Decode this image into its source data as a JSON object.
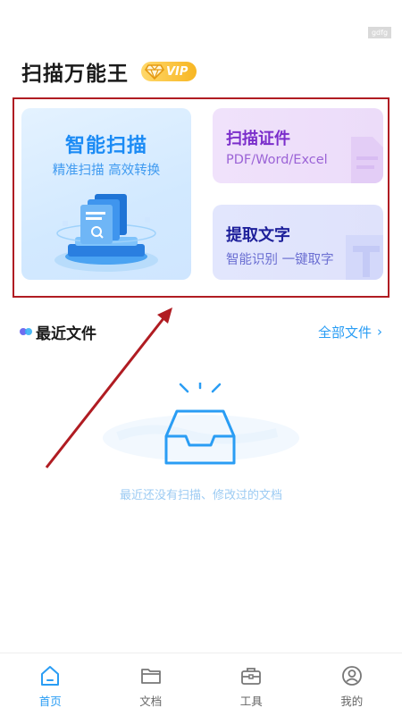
{
  "watermark": {
    "text": "gdfg"
  },
  "header": {
    "title": "扫描万能王",
    "vip_label": "VIP"
  },
  "cards": {
    "smart_scan": {
      "title": "智能扫描",
      "subtitle": "精准扫描 高效转换"
    },
    "scan_id": {
      "title": "扫描证件",
      "subtitle": "PDF/Word/Excel"
    },
    "extract_text": {
      "title": "提取文字",
      "subtitle": "智能识别 一键取字"
    }
  },
  "recent": {
    "title": "最近文件",
    "all_files_label": "全部文件"
  },
  "empty_state": {
    "text": "最近还没有扫描、修改过的文档"
  },
  "tabbar": {
    "items": [
      {
        "label": "首页",
        "icon": "home-icon",
        "active": true
      },
      {
        "label": "文档",
        "icon": "folder-icon",
        "active": false
      },
      {
        "label": "工具",
        "icon": "toolbox-icon",
        "active": false
      },
      {
        "label": "我的",
        "icon": "user-icon",
        "active": false
      }
    ]
  },
  "colors": {
    "accent": "#2a9df4",
    "vip_gold": "#f7b623",
    "annotation_red": "#b01c22",
    "scan_id_purple": "#7b2ecb",
    "extract_text_navy": "#1d1f9a"
  }
}
